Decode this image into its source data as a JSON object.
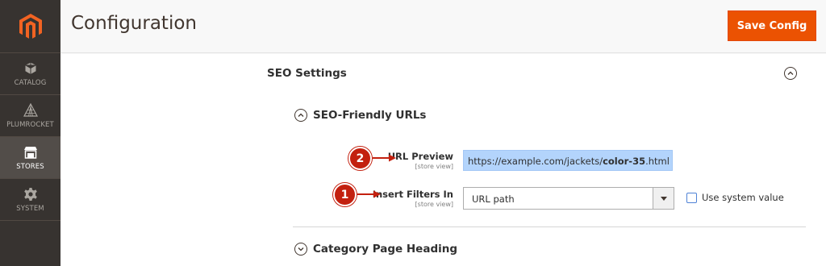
{
  "sidebar": {
    "logo": "magento-logo-icon",
    "items": [
      {
        "label": "CATALOG",
        "icon": "cube-icon",
        "active": false
      },
      {
        "label": "PLUMROCKET",
        "icon": "pyramid-icon",
        "active": false
      },
      {
        "label": "STORES",
        "icon": "store-icon",
        "active": true
      },
      {
        "label": "SYSTEM",
        "icon": "gear-icon",
        "active": false
      }
    ]
  },
  "header": {
    "title": "Configuration",
    "save_label": "Save Config"
  },
  "section": {
    "title": "SEO Settings"
  },
  "subsections": {
    "seo_urls": "SEO-Friendly URLs",
    "category_heading": "Category Page Heading"
  },
  "fields": {
    "url_preview": {
      "label": "URL Preview",
      "scope": "[store view]",
      "value_prefix": "https://example.com/jackets/",
      "value_bold": "color-35",
      "value_suffix": ".html"
    },
    "insert_filters": {
      "label": "Insert Filters In",
      "scope": "[store view]",
      "value": "URL path",
      "checkbox_label": "Use system value"
    }
  },
  "annotations": {
    "badge_1": "1",
    "badge_2": "2"
  },
  "colors": {
    "accent": "#eb5202",
    "sidebar_bg": "#373330",
    "badge": "#c3200f",
    "highlight": "#b3d4fc"
  }
}
